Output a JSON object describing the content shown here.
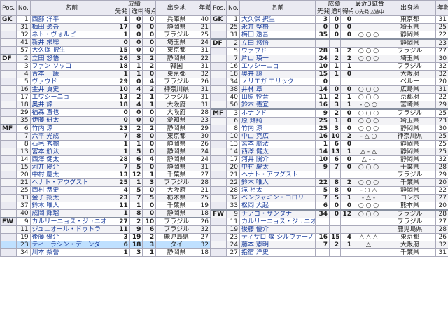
{
  "left": {
    "headers": {
      "pos": "Pos.",
      "no": "No.",
      "name": "名前",
      "record": "成績",
      "starts": "先発",
      "sub": "途中",
      "goals": "得点",
      "origin": "出身地",
      "age": "年齢"
    },
    "rows": [
      {
        "pos": "GK",
        "no": "1",
        "name": "西部 洋平",
        "s": "1",
        "t": "0",
        "g": "0",
        "origin": "兵庫県",
        "age": "40"
      },
      {
        "pos": "",
        "no": "31",
        "name": "梅田 透吾",
        "s": "17",
        "t": "0",
        "g": "0",
        "origin": "静岡県",
        "age": "21"
      },
      {
        "pos": "",
        "no": "32",
        "name": "ネト・ヴォルピ",
        "s": "1",
        "t": "0",
        "g": "0",
        "origin": "ブラジル",
        "age": "25"
      },
      {
        "pos": "",
        "no": "41",
        "name": "新井 栄聡",
        "s": "0",
        "t": "0",
        "g": "0",
        "origin": "埼玉県",
        "age": "24"
      },
      {
        "pos": "",
        "no": "57",
        "name": "大久保 択生",
        "s": "15",
        "t": "0",
        "g": "0",
        "origin": "東京都",
        "age": "31"
      },
      {
        "pos": "DF",
        "no": "2",
        "name": "立田 悠悟",
        "s": "26",
        "t": "3",
        "g": "2",
        "origin": "静岡県",
        "age": "22"
      },
      {
        "pos": "",
        "no": "3",
        "name": "ファン ソッコ",
        "s": "18",
        "t": "1",
        "g": "2",
        "origin": "韓国",
        "age": "31"
      },
      {
        "pos": "",
        "no": "4",
        "name": "吉本 一謙",
        "s": "1",
        "t": "1",
        "g": "0",
        "origin": "東京都",
        "age": "32"
      },
      {
        "pos": "",
        "no": "5",
        "name": "ヴァウド",
        "s": "29",
        "t": "0",
        "g": "4",
        "origin": "ブラジル",
        "age": "26"
      },
      {
        "pos": "",
        "no": "16",
        "name": "金井 貢史",
        "s": "10",
        "t": "4",
        "g": "2",
        "origin": "神奈川県",
        "age": "31"
      },
      {
        "pos": "",
        "no": "17",
        "name": "エウシーニョ",
        "s": "13",
        "t": "2",
        "g": "1",
        "origin": "ブラジル",
        "age": "31"
      },
      {
        "pos": "",
        "no": "18",
        "name": "奥井 諒",
        "s": "18",
        "t": "4",
        "g": "1",
        "origin": "大阪府",
        "age": "31"
      },
      {
        "pos": "",
        "no": "29",
        "name": "福森 直也",
        "s": "0",
        "t": "0",
        "g": "0",
        "origin": "大阪府",
        "age": "28"
      },
      {
        "pos": "",
        "no": "35",
        "name": "伊藤 研太",
        "s": "0",
        "t": "0",
        "g": "0",
        "origin": "愛知県",
        "age": "23"
      },
      {
        "pos": "MF",
        "no": "6",
        "name": "竹内 涼",
        "s": "23",
        "t": "2",
        "g": "2",
        "origin": "静岡県",
        "age": "29"
      },
      {
        "pos": "",
        "no": "7",
        "name": "六平 光成",
        "s": "7",
        "t": "8",
        "g": "0",
        "origin": "東京都",
        "age": "30"
      },
      {
        "pos": "",
        "no": "8",
        "name": "石毛 秀樹",
        "s": "1",
        "t": "1",
        "g": "0",
        "origin": "静岡県",
        "age": "26"
      },
      {
        "pos": "",
        "no": "13",
        "name": "宮本 航汰",
        "s": "1",
        "t": "5",
        "g": "0",
        "origin": "静岡県",
        "age": "24"
      },
      {
        "pos": "",
        "no": "14",
        "name": "西澤 健太",
        "s": "28",
        "t": "6",
        "g": "4",
        "origin": "静岡県",
        "age": "24"
      },
      {
        "pos": "",
        "no": "15",
        "name": "河井 陽介",
        "s": "7",
        "t": "5",
        "g": "0",
        "origin": "静岡県",
        "age": "31"
      },
      {
        "pos": "",
        "no": "20",
        "name": "中村 慶太",
        "s": "13",
        "t": "12",
        "g": "1",
        "origin": "千葉県",
        "age": "27"
      },
      {
        "pos": "",
        "no": "21",
        "name": "ヘナト・アウグスト",
        "s": "25",
        "t": "1",
        "g": "3",
        "origin": "ブラジル",
        "age": "28"
      },
      {
        "pos": "",
        "no": "25",
        "name": "西村 恭史",
        "s": "4",
        "t": "5",
        "g": "0",
        "origin": "大阪府",
        "age": "21"
      },
      {
        "pos": "",
        "no": "33",
        "name": "金子 翔太",
        "s": "23",
        "t": "7",
        "g": "5",
        "origin": "栃木県",
        "age": "25"
      },
      {
        "pos": "",
        "no": "37",
        "name": "鈴木 唯人",
        "s": "11",
        "t": "1",
        "g": "0",
        "origin": "千葉県",
        "age": "19"
      },
      {
        "pos": "",
        "no": "40",
        "name": "成岡 輝瑠",
        "s": "1",
        "t": "8",
        "g": "0",
        "origin": "静岡県",
        "age": "18"
      },
      {
        "pos": "FW",
        "no": "9",
        "name": "カルリーニョス・ジュニオ",
        "s": "27",
        "t": "2",
        "g": "10",
        "origin": "ブラジル",
        "age": "26"
      },
      {
        "pos": "",
        "no": "11",
        "name": "ジュニオール・ドゥトラ",
        "s": "11",
        "t": "9",
        "g": "6",
        "origin": "ブラジル",
        "age": "32"
      },
      {
        "pos": "",
        "no": "19",
        "name": "後藤 優介",
        "s": "3",
        "t": "19",
        "g": "2",
        "origin": "鹿児島県",
        "age": "27"
      },
      {
        "pos": "",
        "no": "23",
        "name": "ティーラシン・デーンダー",
        "s": "6",
        "t": "18",
        "g": "3",
        "origin": "タイ",
        "age": "32",
        "hl": true
      },
      {
        "pos": "",
        "no": "34",
        "name": "川本 梨誉",
        "s": "1",
        "t": "3",
        "g": "1",
        "origin": "静岡県",
        "age": "18"
      }
    ]
  },
  "right": {
    "headers": {
      "pos": "Pos.",
      "no": "No.",
      "name": "名前",
      "record": "成績",
      "starts": "先発",
      "sub": "途中",
      "goals": "得点",
      "recent": "最近3試合",
      "legend1": "○先発",
      "legend2": "△途中",
      "origin": "出身地",
      "age": "年齢"
    },
    "rows": [
      {
        "pos": "GK",
        "no": "1",
        "name": "大久保 択生",
        "s": "3",
        "t": "0",
        "g": "0",
        "r": "",
        "origin": "東京都",
        "age": "31"
      },
      {
        "pos": "",
        "no": "25",
        "name": "永井 堅梧",
        "s": "0",
        "t": "0",
        "g": "0",
        "r": "",
        "origin": "埼玉県",
        "age": "25"
      },
      {
        "pos": "",
        "no": "31",
        "name": "梅田 透吾",
        "s": "35",
        "t": "0",
        "g": "0",
        "r": "○ ○ ○",
        "origin": "静岡県",
        "age": "22"
      },
      {
        "pos": "DF",
        "no": "2",
        "name": "立田 悠悟",
        "s": "",
        "t": "",
        "g": "",
        "r": "",
        "origin": "静岡県",
        "age": "23"
      },
      {
        "pos": "",
        "no": "5",
        "name": "ヴァウド",
        "s": "28",
        "t": "3",
        "g": "2",
        "r": "○ ○ ○",
        "origin": "ブラジル",
        "age": "27"
      },
      {
        "pos": "",
        "no": "7",
        "name": "片山 瑛一",
        "s": "24",
        "t": "2",
        "g": "2",
        "r": "○ ○ ○",
        "origin": "埼玉県",
        "age": "30"
      },
      {
        "pos": "",
        "no": "16",
        "name": "エウシーニョ",
        "s": "10",
        "t": "1",
        "g": "1",
        "r": "",
        "origin": "ブラジル",
        "age": "32"
      },
      {
        "pos": "",
        "no": "18",
        "name": "奥井 諒",
        "s": "15",
        "t": "1",
        "g": "0",
        "r": "",
        "origin": "大阪府",
        "age": "32"
      },
      {
        "pos": "",
        "no": "34",
        "name": "ノリエガ エリック",
        "s": "0",
        "t": "",
        "g": "",
        "r": "",
        "origin": "ペルー",
        "age": "20"
      },
      {
        "pos": "",
        "no": "38",
        "name": "井林 章",
        "s": "14",
        "t": "0",
        "g": "0",
        "r": "○ ○ ○",
        "origin": "広島県",
        "age": "31"
      },
      {
        "pos": "",
        "no": "40",
        "name": "山原 怜音",
        "s": "11",
        "t": "2",
        "g": "1",
        "r": "○ ○ ○",
        "origin": "京都府",
        "age": "22"
      },
      {
        "pos": "",
        "no": "50",
        "name": "鈴木 義宜",
        "s": "16",
        "t": "3",
        "g": "1",
        "r": "-  ○  ○",
        "origin": "宮崎県",
        "age": "29"
      },
      {
        "pos": "MF",
        "no": "3",
        "name": "ホナウド",
        "s": "9",
        "t": "2",
        "g": "0",
        "r": "○ ○ ○",
        "origin": "ブラジル",
        "age": "25"
      },
      {
        "pos": "",
        "no": "6",
        "name": "原 輝綺",
        "s": "25",
        "t": "1",
        "g": "0",
        "r": "○ ○ ○",
        "origin": "埼玉県",
        "age": "23"
      },
      {
        "pos": "",
        "no": "8",
        "name": "竹内 涼",
        "s": "25",
        "t": "3",
        "g": "0",
        "r": "○ ○ ○",
        "origin": "静岡県",
        "age": "30"
      },
      {
        "pos": "",
        "no": "10",
        "name": "中山 克広",
        "s": "16",
        "t": "10",
        "g": "2",
        "r": "-  △  ○",
        "origin": "神奈川県",
        "age": "25"
      },
      {
        "pos": "",
        "no": "13",
        "name": "宮本 航汰",
        "s": "1",
        "t": "6",
        "g": "0",
        "r": "",
        "origin": "静岡県",
        "age": "25"
      },
      {
        "pos": "",
        "no": "14",
        "name": "西澤 健太",
        "s": "14",
        "t": "13",
        "g": "1",
        "r": "△ -  △",
        "origin": "静岡県",
        "age": "25"
      },
      {
        "pos": "",
        "no": "17",
        "name": "河井 陽介",
        "s": "10",
        "t": "6",
        "g": "0",
        "r": "△ -  -",
        "origin": "静岡県",
        "age": "32"
      },
      {
        "pos": "",
        "no": "20",
        "name": "中村 慶太",
        "s": "9",
        "t": "7",
        "g": "0",
        "r": "○ ○ ○",
        "origin": "千葉県",
        "age": "28"
      },
      {
        "pos": "",
        "no": "21",
        "name": "ヘナト・アウグスト",
        "s": "",
        "t": "",
        "g": "",
        "r": "",
        "origin": "ブラジル",
        "age": "29"
      },
      {
        "pos": "",
        "no": "22",
        "name": "鈴木 唯人",
        "s": "22",
        "t": "8",
        "g": "2",
        "r": "○ ○ ○",
        "origin": "千葉県",
        "age": "20"
      },
      {
        "pos": "",
        "no": "28",
        "name": "滝 裕太",
        "s": "5",
        "t": "8",
        "g": "0",
        "r": "-  ○  △",
        "origin": "静岡県",
        "age": "22"
      },
      {
        "pos": "",
        "no": "32",
        "name": "ベンジャミン・コロリ",
        "s": "7",
        "t": "5",
        "g": "1",
        "r": "-  △  -",
        "origin": "コンポ",
        "age": "27"
      },
      {
        "pos": "",
        "no": "33",
        "name": "松岡 大起",
        "s": "6",
        "t": "0",
        "g": "0",
        "r": "○ ○ ○",
        "origin": "熊本県",
        "age": "20"
      },
      {
        "pos": "FW",
        "no": "9",
        "name": "チアゴ・サンタナ",
        "s": "34",
        "t": "0",
        "g": "12",
        "r": "○ ○ ○",
        "origin": "ブラジル",
        "age": "28"
      },
      {
        "pos": "",
        "no": "11",
        "name": "カルリーニョス・ジュニオ",
        "s": "",
        "t": "",
        "g": "",
        "r": "",
        "origin": "ブラジル",
        "age": "27"
      },
      {
        "pos": "",
        "no": "19",
        "name": "後藤 優介",
        "s": "",
        "t": "",
        "g": "",
        "r": "",
        "origin": "鹿児島県",
        "age": "28"
      },
      {
        "pos": "",
        "no": "23",
        "name": "ディサロ 燦 シルヴァーノ",
        "s": "16",
        "t": "15",
        "g": "4",
        "r": "△ △ △",
        "origin": "東京都",
        "age": "26"
      },
      {
        "pos": "",
        "no": "24",
        "name": "藤本 憲明",
        "s": "7",
        "t": "2",
        "g": "1",
        "r": "△",
        "origin": "大阪府",
        "age": "32"
      },
      {
        "pos": "",
        "no": "27",
        "name": "指宿 洋史",
        "s": "",
        "t": "",
        "g": "",
        "r": "",
        "origin": "千葉県",
        "age": "31"
      }
    ]
  }
}
